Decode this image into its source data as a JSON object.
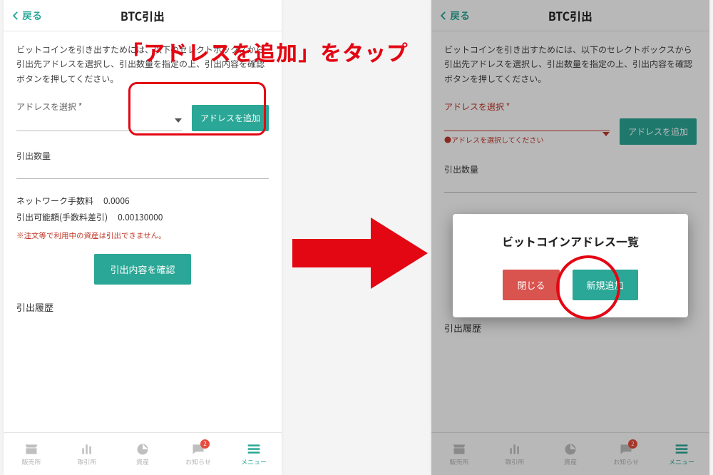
{
  "annotation": {
    "headline": "「アドレスを追加」をタップ"
  },
  "header": {
    "back": "戻る",
    "title": "BTC引出"
  },
  "description": "ビットコインを引き出すためには、以下のセレクトボックスから引出先アドレスを選択し、引出数量を指定の上、引出内容を確認ボタンを押してください。",
  "select": {
    "label": "アドレスを選択 *",
    "error": "●アドレスを選択してください",
    "add_btn": "アドレスを追加"
  },
  "qty_label": "引出数量",
  "fee": {
    "network_label": "ネットワーク手数料",
    "network_value": "0.0006",
    "avail_label": "引出可能額(手数料差引)",
    "avail_value": "0.00130000"
  },
  "warning": "※注文等で利用中の資産は引出できません。",
  "confirm_btn": "引出内容を確認",
  "history_label": "引出履歴",
  "nav": {
    "items": [
      "販売所",
      "取引所",
      "資産",
      "お知らせ",
      "メニュー"
    ],
    "badge": "2"
  },
  "modal": {
    "title": "ビットコインアドレス一覧",
    "close": "閉じる",
    "add": "新規追加"
  }
}
